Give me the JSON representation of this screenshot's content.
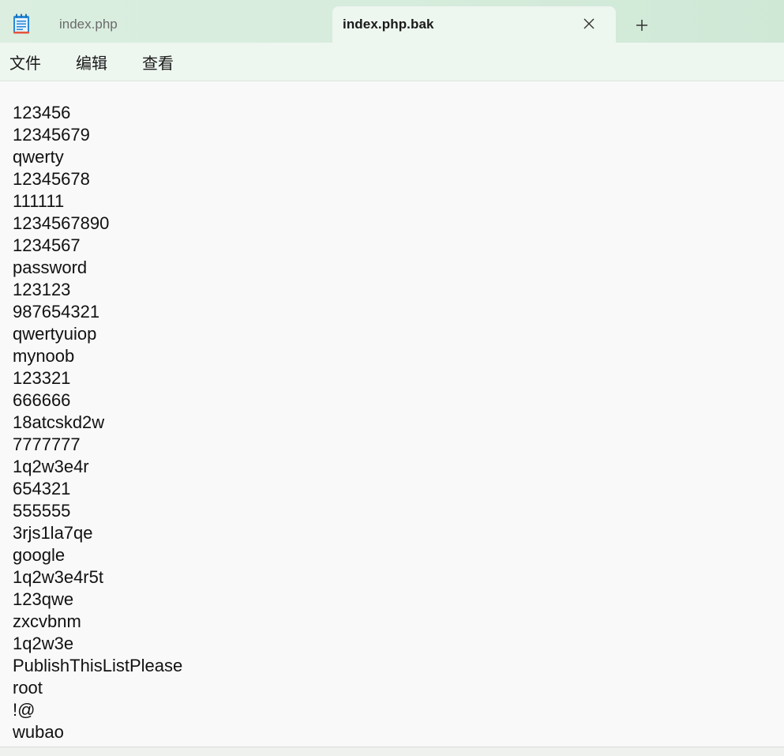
{
  "window": {
    "tabs": [
      {
        "label": "index.php",
        "active": false
      },
      {
        "label": "index.php.bak",
        "active": true
      }
    ],
    "close_icon": "close-icon",
    "new_tab_icon": "plus-icon",
    "app_icon": "notepad-icon"
  },
  "menu": {
    "file": "文件",
    "edit": "编辑",
    "view": "查看"
  },
  "editor": {
    "lines": [
      "123456",
      "12345679",
      "qwerty",
      "12345678",
      "111111",
      "1234567890",
      "1234567",
      "password",
      "123123",
      "987654321",
      "qwertyuiop",
      "mynoob",
      "123321",
      "666666",
      "18atcskd2w",
      "7777777",
      "1q2w3e4r",
      "654321",
      "555555",
      "3rjs1la7qe",
      "google",
      "1q2w3e4r5t",
      "123qwe",
      "zxcvbnm",
      "1q2w3e",
      "PublishThisListPlease",
      "root",
      "!@",
      "wubao"
    ]
  },
  "colors": {
    "titlebar": "#d6ecdc",
    "active_tab": "#eef6f0",
    "editor_bg": "#f9f9f9",
    "text": "#111111"
  }
}
